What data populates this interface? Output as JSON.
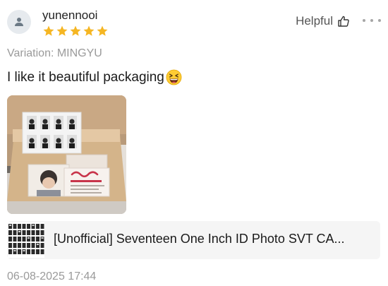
{
  "review": {
    "username": "yunennooi",
    "rating": 5,
    "rating_max": 5,
    "helpful_label": "Helpful",
    "variation": "Variation: MINGYU",
    "text": "I like it beautiful packaging",
    "emoji": "grinning-squinting-face",
    "timestamp": "06-08-2025 17:44"
  },
  "product": {
    "title": "[Unofficial] Seventeen One Inch ID Photo SVT CA..."
  },
  "icons": {
    "avatar": "user-icon",
    "helpful": "thumbs-up-icon",
    "more": "more-icon",
    "star": "star-icon"
  },
  "colors": {
    "star": "#f5b623",
    "muted_text": "#9a9a9a",
    "product_bg": "#f5f5f5"
  }
}
